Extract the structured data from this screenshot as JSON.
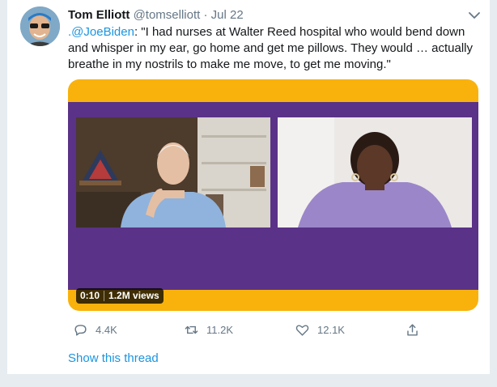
{
  "tweet": {
    "author_name": "Tom Elliott",
    "handle": "@tomselliott",
    "separator": "·",
    "date": "Jul 22",
    "mention": ".@JoeBiden",
    "text": ": \"I had nurses at Walter Reed hospital who would bend down and whisper in my ear, go home and get me pillows. They would … actually breathe in my nostrils to make me move, to get me moving.\""
  },
  "video": {
    "timestamp": "0:10",
    "views": "1.2M views"
  },
  "actions": {
    "reply_count": "4.4K",
    "retweet_count": "11.2K",
    "like_count": "12.1K"
  },
  "thread_link": "Show this thread",
  "icons": {
    "caret": "chevron-down-icon",
    "reply": "reply-icon",
    "retweet": "retweet-icon",
    "like": "heart-icon",
    "share": "share-icon"
  },
  "colors": {
    "link": "#1b95e0",
    "muted": "#657786",
    "video_frame": "#f9b20c",
    "video_band": "#5a3288"
  }
}
